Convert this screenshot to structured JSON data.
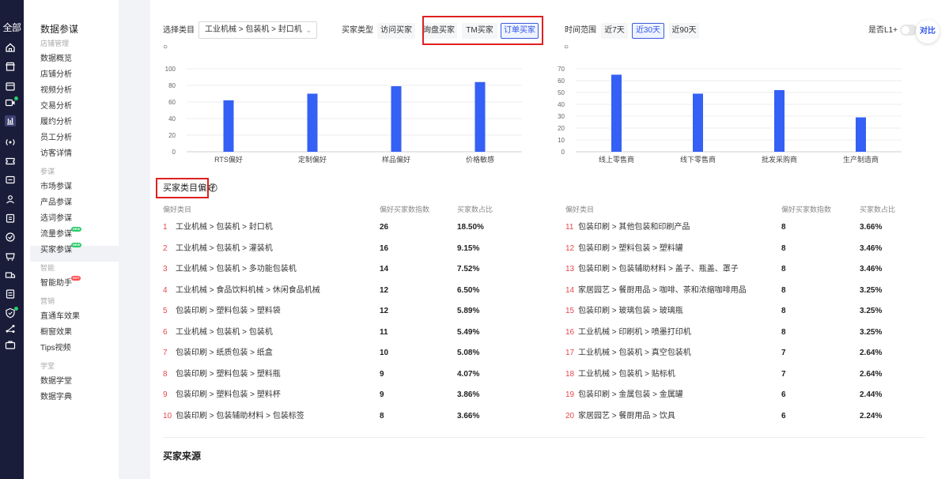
{
  "rail": {
    "all_label": "全部",
    "icons": [
      "home-icon",
      "store-icon",
      "calendar-icon",
      "video-icon",
      "bar-chart-icon",
      "broadcast-icon",
      "ticket-icon",
      "message-icon",
      "users-icon",
      "clipboard-icon",
      "target-icon",
      "cart-icon",
      "truck-icon",
      "doc-icon",
      "shield-icon",
      "share-icon",
      "briefcase-icon"
    ]
  },
  "subnav": {
    "title": "数据参谋",
    "groups": [
      {
        "label": "店铺管理",
        "items": [
          "数据概览",
          "店铺分析",
          "视频分析",
          "交易分析",
          "履约分析",
          "员工分析",
          "访客详情"
        ]
      },
      {
        "label": "参谋",
        "items": [
          "市场参谋",
          "产品参谋",
          "选词参谋",
          "流量参谋",
          "买家参谋"
        ]
      },
      {
        "label": "智能",
        "items": [
          "智能助手"
        ]
      },
      {
        "label": "营销",
        "items": [
          "直通车效果",
          "橱窗效果",
          "Tips视频"
        ]
      },
      {
        "label": "学堂",
        "items": [
          "数据学堂",
          "数据字典"
        ]
      }
    ],
    "badges": {
      "flow": "NEW",
      "buyer": "NEW",
      "assistant": "HOT"
    }
  },
  "filters": {
    "category_label": "选择类目",
    "category_value": "工业机械 > 包装机 > 封口机",
    "buyer_type_label": "买家类型",
    "buyer_types": [
      "访问买家",
      "询盘买家",
      "TM买家",
      "订单买家"
    ],
    "buyer_type_selected": "订单买家",
    "time_label": "时间范围",
    "time_options": [
      "近7天",
      "近30天",
      "近90天"
    ],
    "time_selected": "近30天",
    "l1_label": "是否L1+",
    "compare_label": "对比"
  },
  "chart_data": [
    {
      "type": "bar",
      "categories": [
        "RTS偏好",
        "定制偏好",
        "样品偏好",
        "价格敏感"
      ],
      "values": [
        62,
        70,
        79,
        84
      ],
      "ylim": [
        0,
        100
      ],
      "yticks": [
        "0",
        "20",
        "40",
        "60",
        "80",
        "100"
      ],
      "grid": true,
      "color": "#3560f5"
    },
    {
      "type": "bar",
      "categories": [
        "线上零售商",
        "线下零售商",
        "批发采购商",
        "生产制造商"
      ],
      "values": [
        65,
        49,
        52,
        29
      ],
      "ylim": [
        0,
        70
      ],
      "yticks": [
        "0",
        "10",
        "20",
        "30",
        "40",
        "50",
        "60",
        "70"
      ],
      "grid": true,
      "color": "#3560f5"
    }
  ],
  "pref": {
    "title": "买家类目偏好",
    "headers": {
      "category": "偏好类目",
      "index": "偏好买家数指数",
      "share": "买家数占比"
    },
    "left": [
      {
        "rank": "1",
        "name": "工业机械 > 包装机 > 封口机",
        "index": "26",
        "share": "18.50%"
      },
      {
        "rank": "2",
        "name": "工业机械 > 包装机 > 灌装机",
        "index": "16",
        "share": "9.15%"
      },
      {
        "rank": "3",
        "name": "工业机械 > 包装机 > 多功能包装机",
        "index": "14",
        "share": "7.52%"
      },
      {
        "rank": "4",
        "name": "工业机械 > 食品饮料机械 > 休闲食品机械",
        "index": "12",
        "share": "6.50%"
      },
      {
        "rank": "5",
        "name": "包装印刷 > 塑料包装 > 塑料袋",
        "index": "12",
        "share": "5.89%"
      },
      {
        "rank": "6",
        "name": "工业机械 > 包装机 > 包装机",
        "index": "11",
        "share": "5.49%"
      },
      {
        "rank": "7",
        "name": "包装印刷 > 纸质包装 > 纸盒",
        "index": "10",
        "share": "5.08%"
      },
      {
        "rank": "8",
        "name": "包装印刷 > 塑料包装 > 塑料瓶",
        "index": "9",
        "share": "4.07%"
      },
      {
        "rank": "9",
        "name": "包装印刷 > 塑料包装 > 塑料杯",
        "index": "9",
        "share": "3.86%"
      },
      {
        "rank": "10",
        "name": "包装印刷 > 包装辅助材料 > 包装标签",
        "index": "8",
        "share": "3.66%"
      }
    ],
    "right": [
      {
        "rank": "11",
        "name": "包装印刷 > 其他包装和印刷产品",
        "index": "8",
        "share": "3.66%"
      },
      {
        "rank": "12",
        "name": "包装印刷 > 塑料包装 > 塑料罐",
        "index": "8",
        "share": "3.46%"
      },
      {
        "rank": "13",
        "name": "包装印刷 > 包装辅助材料 > 盖子、瓶盖、罩子",
        "index": "8",
        "share": "3.46%"
      },
      {
        "rank": "14",
        "name": "家居园艺 > 餐厨用品 > 咖啡、茶和浓缩咖啡用品",
        "index": "8",
        "share": "3.25%"
      },
      {
        "rank": "15",
        "name": "包装印刷 > 玻璃包装 > 玻璃瓶",
        "index": "8",
        "share": "3.25%"
      },
      {
        "rank": "16",
        "name": "工业机械 > 印刷机 > 喷墨打印机",
        "index": "8",
        "share": "3.25%"
      },
      {
        "rank": "17",
        "name": "工业机械 > 包装机 > 真空包装机",
        "index": "7",
        "share": "2.64%"
      },
      {
        "rank": "18",
        "name": "工业机械 > 包装机 > 贴标机",
        "index": "7",
        "share": "2.64%"
      },
      {
        "rank": "19",
        "name": "包装印刷 > 金属包装 > 金属罐",
        "index": "6",
        "share": "2.44%"
      },
      {
        "rank": "20",
        "name": "家居园艺 > 餐厨用品 > 饮具",
        "index": "6",
        "share": "2.24%"
      }
    ]
  },
  "next_section": "买家来源"
}
